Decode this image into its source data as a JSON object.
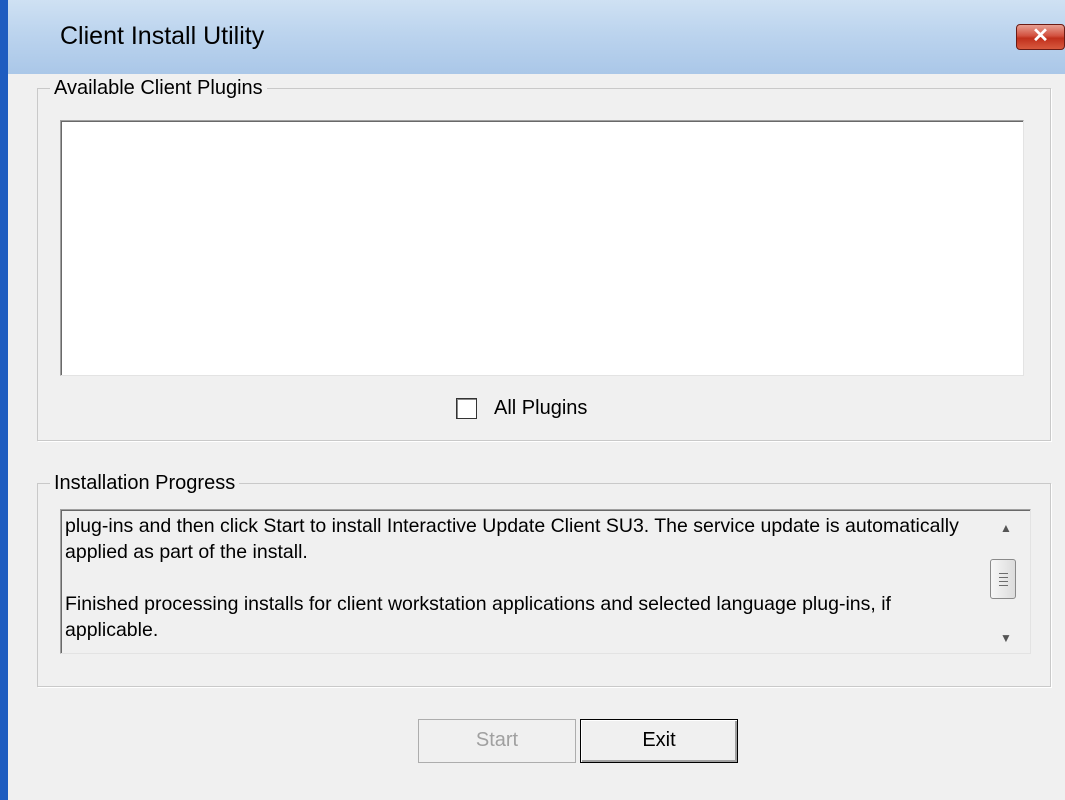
{
  "window": {
    "title": "Client Install Utility",
    "close_label": "✕"
  },
  "plugins_group": {
    "legend": "Available Client Plugins",
    "items": [],
    "all_plugins_label": "All Plugins",
    "all_plugins_checked": false
  },
  "progress_group": {
    "legend": "Installation Progress",
    "lines": [
      "plug-ins and then click Start to install Interactive Update Client SU3. The service update is automatically applied as part of the install.",
      "Finished processing installs for client workstation applications and selected language plug-ins, if applicable."
    ]
  },
  "buttons": {
    "start_label": "Start",
    "start_enabled": false,
    "exit_label": "Exit"
  },
  "colors": {
    "titlebar": "#bcd4ee",
    "close_button": "#c0301c",
    "dialog_face": "#f0f0f0"
  }
}
